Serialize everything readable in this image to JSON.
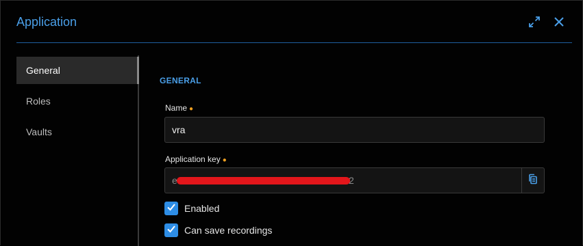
{
  "dialog": {
    "title": "Application",
    "expand_icon": "expand-icon",
    "close_icon": "close-icon"
  },
  "sidebar": {
    "items": [
      {
        "label": "General",
        "active": true
      },
      {
        "label": "Roles",
        "active": false
      },
      {
        "label": "Vaults",
        "active": false
      }
    ]
  },
  "general": {
    "section_title": "GENERAL",
    "name_label": "Name",
    "name_value": "vra",
    "key_label": "Application key",
    "key_value_start": "e",
    "key_value_end": "2",
    "copy_icon": "copy-icon",
    "required_marker": "●",
    "enabled_label": "Enabled",
    "enabled_checked": true,
    "recordings_label": "Can save recordings",
    "recordings_checked": true
  },
  "colors": {
    "accent": "#4a9fe8",
    "checkbox": "#2d8de6",
    "required": "#f0a020",
    "redaction": "#e3161b"
  }
}
